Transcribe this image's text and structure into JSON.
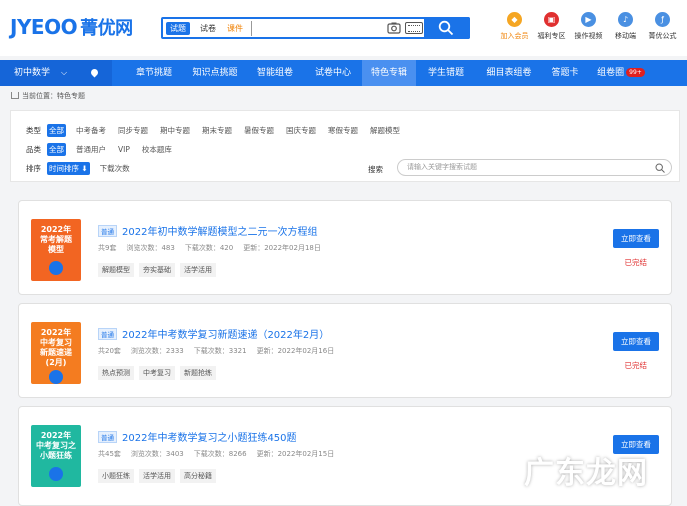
{
  "header": {
    "logo_en": "JYEOO",
    "logo_cn": "菁优网",
    "search": {
      "tabs": [
        "试题",
        "试卷",
        "课件"
      ],
      "value": "",
      "placeholder": ""
    },
    "icons": [
      {
        "label": "加入会员",
        "icon": "vip-icon",
        "color": "#f5a623"
      },
      {
        "label": "福利专区",
        "icon": "gift-icon",
        "color": "#e03030"
      },
      {
        "label": "操作视频",
        "icon": "play-icon",
        "color": "#4a90e2"
      },
      {
        "label": "移动端",
        "icon": "mobile-icon",
        "color": "#4a90e2"
      },
      {
        "label": "菁优公式",
        "icon": "formula-icon",
        "color": "#4a90e2"
      }
    ]
  },
  "nav": {
    "subject": "初中数学",
    "items": [
      "章节挑题",
      "知识点挑题",
      "智能组卷",
      "试卷中心",
      "特色专辑",
      "学生错题",
      "细目表组卷",
      "答题卡",
      "组卷圈"
    ],
    "badge": "99+",
    "active": "特色专辑"
  },
  "breadcrumb": {
    "label": "当前位置：",
    "current": "特色专题"
  },
  "filters": {
    "type": {
      "label": "类型",
      "options": [
        "全部",
        "中考备考",
        "同步专题",
        "期中专题",
        "期末专题",
        "暑假专题",
        "国庆专题",
        "寒假专题",
        "解题模型"
      ]
    },
    "category": {
      "label": "品类",
      "options": [
        "全部",
        "普通用户",
        "VIP",
        "校本题库"
      ]
    },
    "sort": {
      "label": "排序",
      "options": [
        "时间排序",
        "下载次数"
      ]
    },
    "search": {
      "label": "搜索",
      "placeholder": "请输入关键字搜索试题"
    }
  },
  "cards": [
    {
      "thumb_text": [
        "2022年",
        "常考解题",
        "模型"
      ],
      "tag": "普通",
      "title": "2022年初中数学解题模型之二元一次方程组",
      "count": "共9套",
      "views": "浏览次数：483",
      "downloads": "下载次数：420",
      "updated": "更新：2022年02月18日",
      "tags": [
        "解题模型",
        "夯实基础",
        "活学活用"
      ],
      "button": "立即查看",
      "status": "已完结"
    },
    {
      "thumb_text": [
        "2022年",
        "中考复习",
        "新题速递",
        "(2月)"
      ],
      "tag": "普通",
      "title": "2022年中考数学复习新题速递（2022年2月）",
      "count": "共20套",
      "views": "浏览次数：2333",
      "downloads": "下载次数：3321",
      "updated": "更新：2022年02月16日",
      "tags": [
        "热点预测",
        "中考复习",
        "新题抢练"
      ],
      "button": "立即查看",
      "status": "已完结"
    },
    {
      "thumb_text": [
        "2022年",
        "中考复习之",
        "小题狂练"
      ],
      "tag": "普通",
      "title": "2022年中考数学复习之小题狂练450题",
      "count": "共45套",
      "views": "浏览次数：3403",
      "downloads": "下载次数：8266",
      "updated": "更新：2022年02月15日",
      "tags": [
        "小题狂练",
        "活学活用",
        "高分秘籍"
      ],
      "button": "立即查看",
      "status": ""
    }
  ],
  "watermark": "广东龙网"
}
